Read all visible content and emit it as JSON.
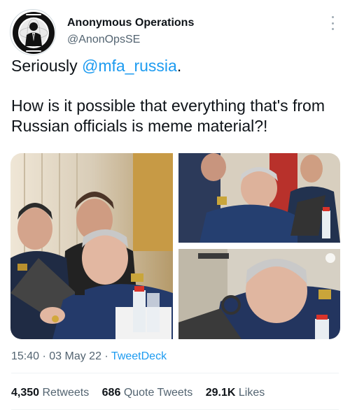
{
  "author": {
    "display_name": "Anonymous Operations",
    "handle": "@AnonOpsSE",
    "avatar_icon": "anonymous-logo-icon"
  },
  "tweet": {
    "line1_prefix": "Seriously ",
    "mention": "@mfa_russia",
    "line1_suffix": ".",
    "line2": "How is it possible that everything that's from Russian officials is meme material?!"
  },
  "media": {
    "photos": [
      "photo-officials-laptop",
      "photo-official-zoom",
      "photo-official-closeup"
    ]
  },
  "meta": {
    "time": "15:40",
    "sep1": " · ",
    "date": "03 May 22",
    "sep2": " · ",
    "source": "TweetDeck"
  },
  "stats": {
    "retweets_count": "4,350",
    "retweets_label": "Retweets",
    "quotes_count": "686",
    "quotes_label": "Quote Tweets",
    "likes_count": "29.1K",
    "likes_label": "Likes"
  },
  "colors": {
    "accent": "#1d9bf0",
    "text": "#0f1419",
    "secondary": "#536471"
  }
}
